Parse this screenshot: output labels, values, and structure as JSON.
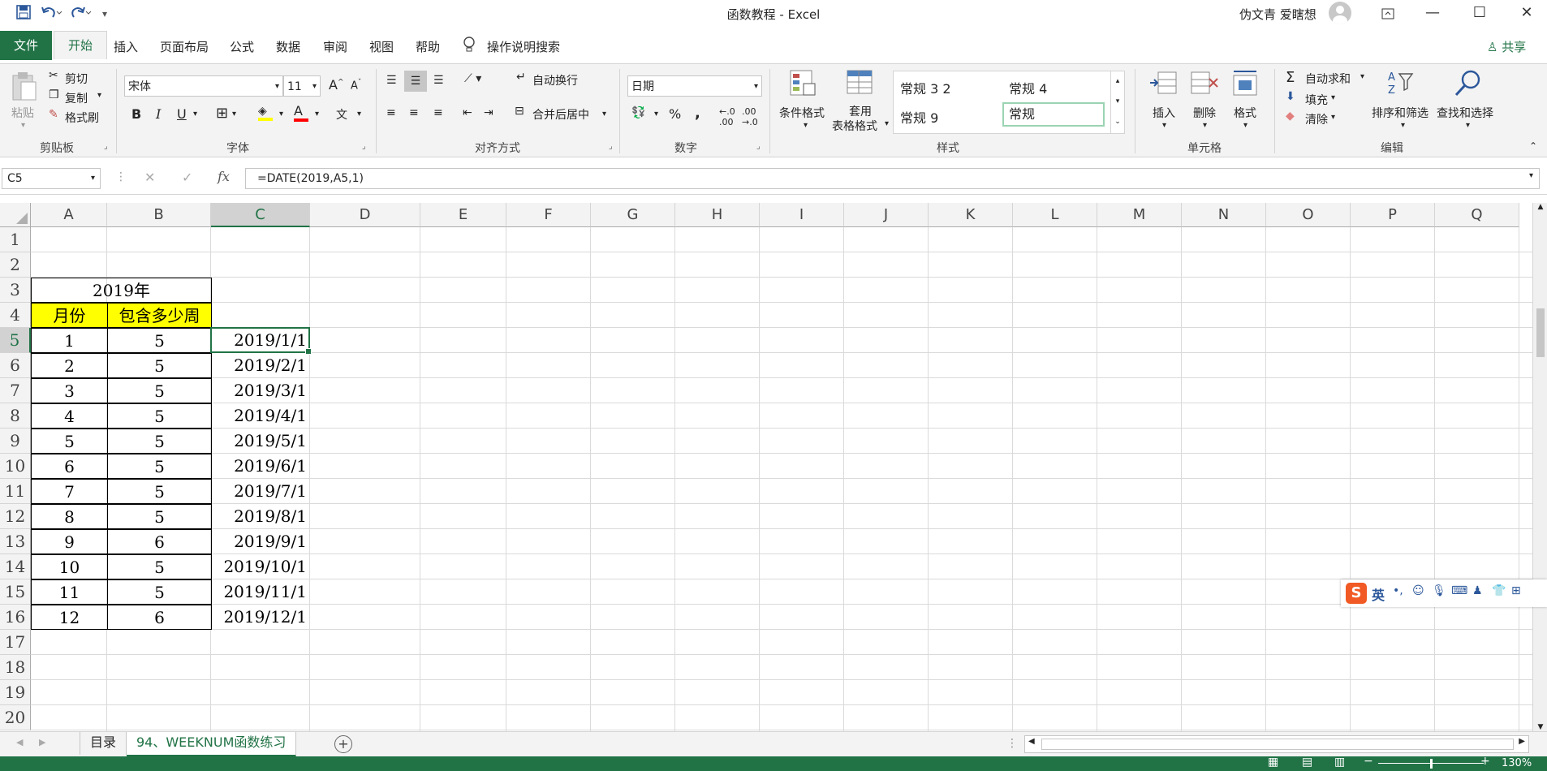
{
  "window": {
    "title": "函数教程  -  Excel",
    "user": "伪文青 爱瞎想",
    "qat_icons": [
      "save-icon",
      "undo-icon",
      "redo-icon",
      "customize-qat-icon"
    ]
  },
  "tabs": {
    "file": "文件",
    "items": [
      "开始",
      "插入",
      "页面布局",
      "公式",
      "数据",
      "审阅",
      "视图",
      "帮助"
    ],
    "tell_me": "操作说明搜索",
    "share": "共享"
  },
  "ribbon": {
    "clipboard": {
      "paste": "粘贴",
      "cut": "剪切",
      "copy": "复制",
      "format_painter": "格式刷",
      "label": "剪贴板"
    },
    "font": {
      "name": "宋体",
      "size": "11",
      "label": "字体",
      "bold": "B",
      "italic": "I",
      "underline": "U",
      "grow": "A",
      "shrink": "A",
      "font_color": "A",
      "phonetic": "文"
    },
    "alignment": {
      "wrap": "自动换行",
      "merge": "合并后居中",
      "label": "对齐方式"
    },
    "number": {
      "format": "日期",
      "percent": "%",
      "comma": ",",
      "label": "数字"
    },
    "styles": {
      "conditional": "条件格式",
      "table_line1": "套用",
      "table_line2": "表格格式",
      "gallery": [
        "常规 3 2",
        "常规 4",
        "常规 9",
        "常规"
      ],
      "label": "样式"
    },
    "cells": {
      "insert": "插入",
      "delete": "删除",
      "format": "格式",
      "label": "单元格"
    },
    "editing": {
      "autosum": "自动求和",
      "fill": "填充",
      "clear": "清除",
      "sort": "排序和筛选",
      "find": "查找和选择",
      "label": "编辑"
    }
  },
  "formula_bar": {
    "name_box": "C5",
    "formula": "=DATE(2019,A5,1)",
    "fx": "fx"
  },
  "sheet": {
    "columns": [
      "A",
      "B",
      "C",
      "D",
      "E",
      "F",
      "G",
      "H",
      "I",
      "J",
      "K",
      "L",
      "M",
      "N",
      "O",
      "P",
      "Q"
    ],
    "rows": [
      "1",
      "2",
      "3",
      "4",
      "5",
      "6",
      "7",
      "8",
      "9",
      "10",
      "11",
      "12",
      "13",
      "14",
      "15",
      "16",
      "17",
      "18",
      "19",
      "20"
    ],
    "title": "2019年",
    "header_month": "月份",
    "header_weeks": "包含多少周",
    "data": [
      {
        "month": "1",
        "weeks": "5",
        "date": "2019/1/1"
      },
      {
        "month": "2",
        "weeks": "5",
        "date": "2019/2/1"
      },
      {
        "month": "3",
        "weeks": "5",
        "date": "2019/3/1"
      },
      {
        "month": "4",
        "weeks": "5",
        "date": "2019/4/1"
      },
      {
        "month": "5",
        "weeks": "5",
        "date": "2019/5/1"
      },
      {
        "month": "6",
        "weeks": "5",
        "date": "2019/6/1"
      },
      {
        "month": "7",
        "weeks": "5",
        "date": "2019/7/1"
      },
      {
        "month": "8",
        "weeks": "5",
        "date": "2019/8/1"
      },
      {
        "month": "9",
        "weeks": "6",
        "date": "2019/9/1"
      },
      {
        "month": "10",
        "weeks": "5",
        "date": "2019/10/1"
      },
      {
        "month": "11",
        "weeks": "5",
        "date": "2019/11/1"
      },
      {
        "month": "12",
        "weeks": "6",
        "date": "2019/12/1"
      }
    ]
  },
  "sheet_tabs": [
    "目录",
    "94、WEEKNUM函数练习"
  ],
  "status": {
    "zoom": "130%"
  },
  "ime": {
    "lang": "英"
  },
  "colors": {
    "excel_green": "#217346",
    "header_yellow": "#ffff00"
  }
}
